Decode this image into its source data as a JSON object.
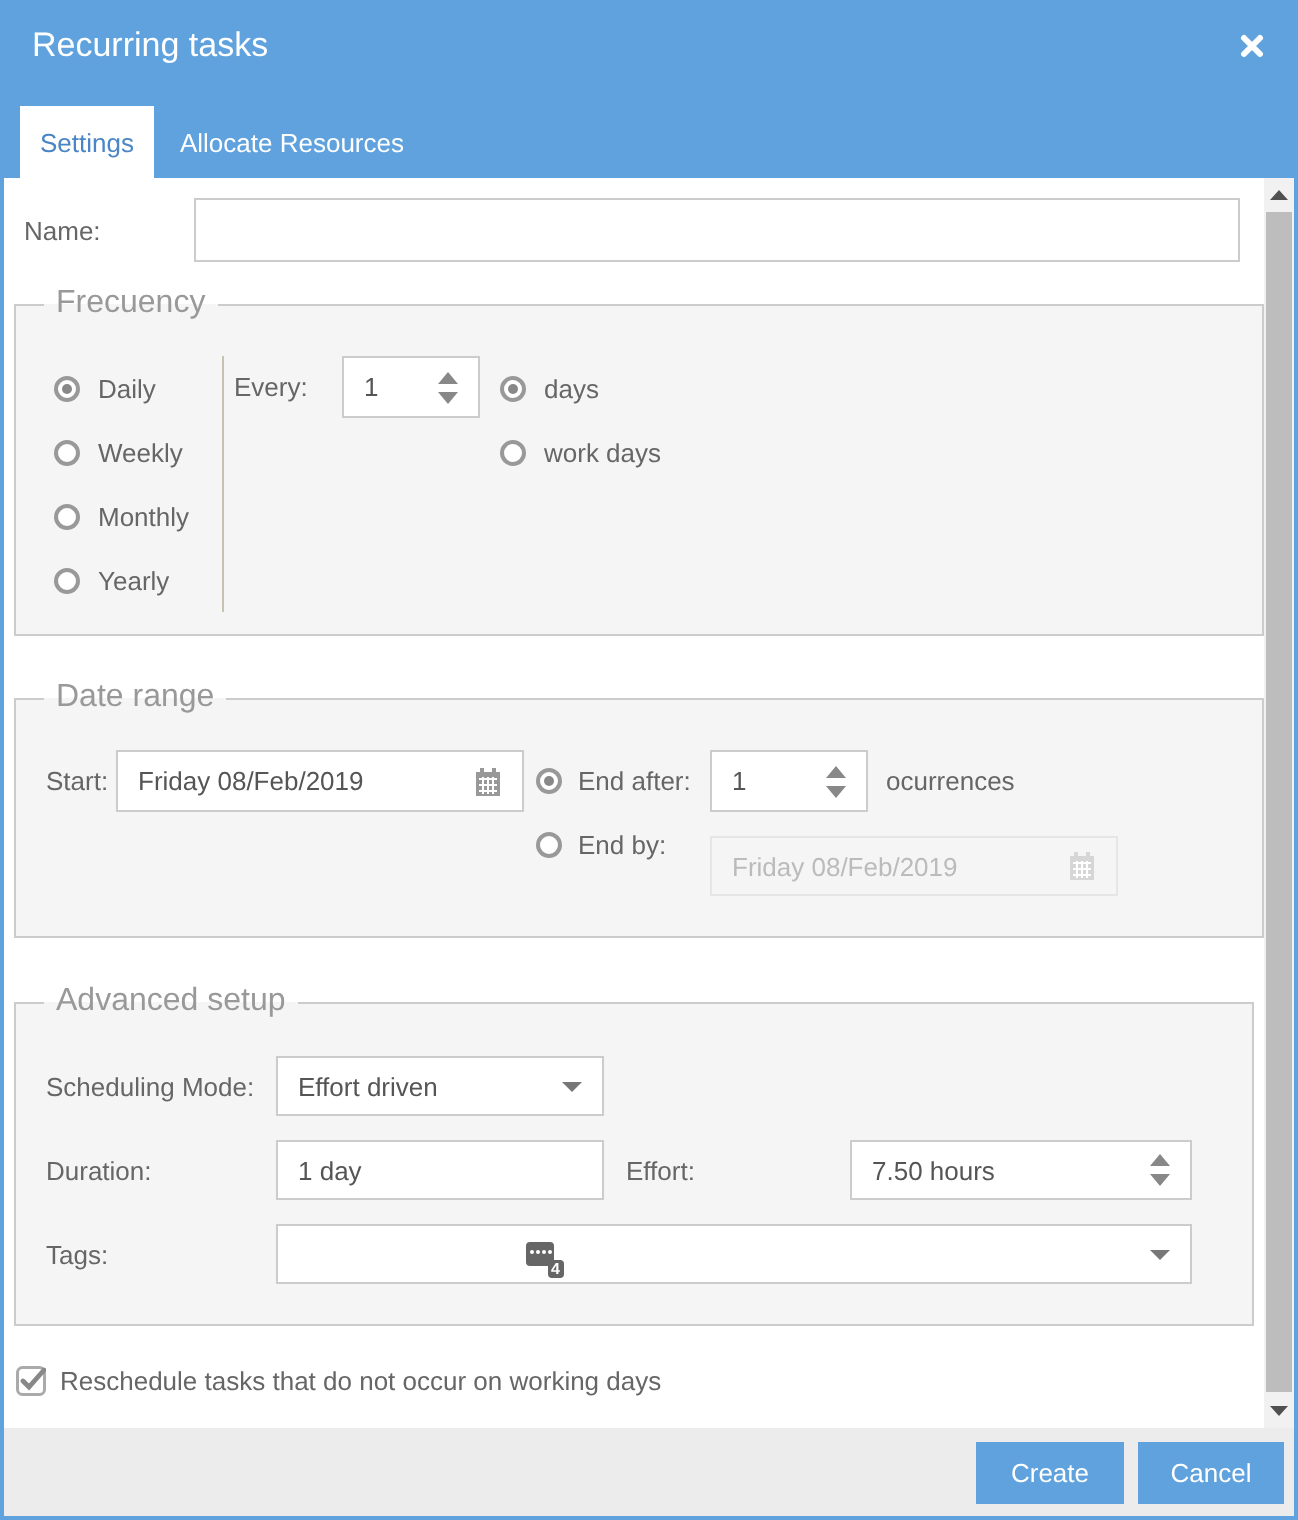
{
  "window": {
    "title": "Recurring tasks"
  },
  "tabs": [
    {
      "label": "Settings",
      "selected": true
    },
    {
      "label": "Allocate Resources",
      "selected": false
    }
  ],
  "name_field": {
    "label": "Name:"
  },
  "frequency": {
    "legend": "Frecuency",
    "periods": [
      {
        "label": "Daily",
        "selected": true
      },
      {
        "label": "Weekly",
        "selected": false
      },
      {
        "label": "Monthly",
        "selected": false
      },
      {
        "label": "Yearly",
        "selected": false
      }
    ],
    "every": {
      "label": "Every:",
      "value": "1"
    },
    "units": [
      {
        "label": "days",
        "selected": true
      },
      {
        "label": "work days",
        "selected": false
      }
    ]
  },
  "date_range": {
    "legend": "Date range",
    "start": {
      "label": "Start:",
      "value": "Friday 08/Feb/2019"
    },
    "end_options": [
      {
        "kind": "count",
        "label": "End after:",
        "selected": true,
        "disabled": false,
        "value": "1",
        "suffix": "ocurrences"
      },
      {
        "kind": "date",
        "label": "End by:",
        "selected": false,
        "disabled": true,
        "value": "Friday 08/Feb/2019"
      }
    ]
  },
  "advanced": {
    "legend": "Advanced setup",
    "scheduling_mode": {
      "label": "Scheduling Mode:",
      "value": "Effort driven"
    },
    "duration": {
      "label": "Duration:",
      "value": "1 day"
    },
    "effort": {
      "label": "Effort:",
      "value": "7.50 hours"
    },
    "tags": {
      "label": "Tags:",
      "count": "4"
    }
  },
  "reschedule": {
    "label": "Reschedule tasks that do not occur on working days",
    "checked": true
  },
  "buttons": [
    {
      "label": "Create"
    },
    {
      "label": "Cancel"
    }
  ]
}
